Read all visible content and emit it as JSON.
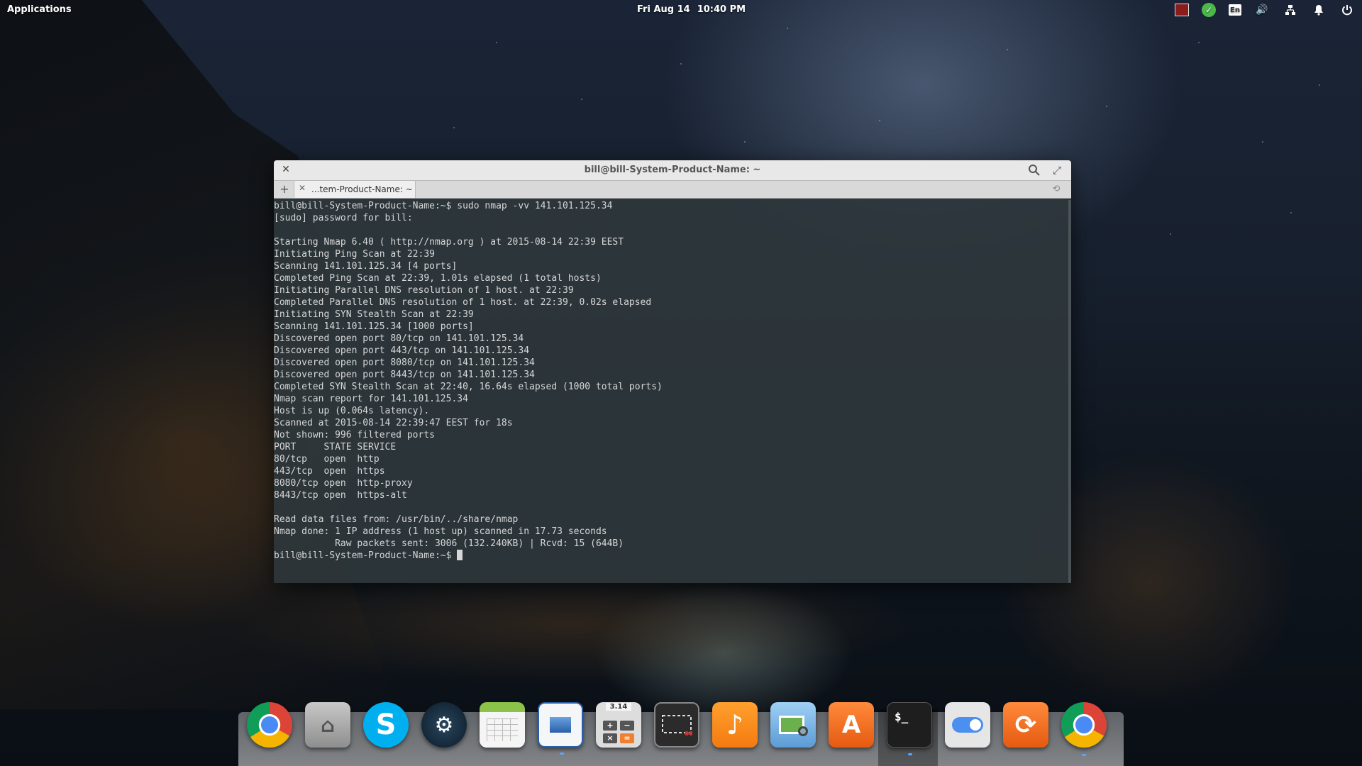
{
  "panel": {
    "applications_label": "Applications",
    "date": "Fri Aug 14",
    "time": "10:40 PM",
    "tray_lang": "En"
  },
  "terminal": {
    "window_title": "bill@bill-System-Product-Name: ~",
    "tab_label": "...tem-Product-Name: ~",
    "lines": [
      "bill@bill-System-Product-Name:~$ sudo nmap -vv 141.101.125.34",
      "[sudo] password for bill:",
      "",
      "Starting Nmap 6.40 ( http://nmap.org ) at 2015-08-14 22:39 EEST",
      "Initiating Ping Scan at 22:39",
      "Scanning 141.101.125.34 [4 ports]",
      "Completed Ping Scan at 22:39, 1.01s elapsed (1 total hosts)",
      "Initiating Parallel DNS resolution of 1 host. at 22:39",
      "Completed Parallel DNS resolution of 1 host. at 22:39, 0.02s elapsed",
      "Initiating SYN Stealth Scan at 22:39",
      "Scanning 141.101.125.34 [1000 ports]",
      "Discovered open port 80/tcp on 141.101.125.34",
      "Discovered open port 443/tcp on 141.101.125.34",
      "Discovered open port 8080/tcp on 141.101.125.34",
      "Discovered open port 8443/tcp on 141.101.125.34",
      "Completed SYN Stealth Scan at 22:40, 16.64s elapsed (1000 total ports)",
      "Nmap scan report for 141.101.125.34",
      "Host is up (0.064s latency).",
      "Scanned at 2015-08-14 22:39:47 EEST for 18s",
      "Not shown: 996 filtered ports",
      "PORT     STATE SERVICE",
      "80/tcp   open  http",
      "443/tcp  open  https",
      "8080/tcp open  http-proxy",
      "8443/tcp open  https-alt",
      "",
      "Read data files from: /usr/bin/../share/nmap",
      "Nmap done: 1 IP address (1 host up) scanned in 17.73 seconds",
      "           Raw packets sent: 3006 (132.240KB) | Rcvd: 15 (644B)"
    ],
    "prompt": "bill@bill-System-Product-Name:~$ "
  },
  "dock": {
    "calc_display": "3.14",
    "terminal_glyph": "$_"
  }
}
